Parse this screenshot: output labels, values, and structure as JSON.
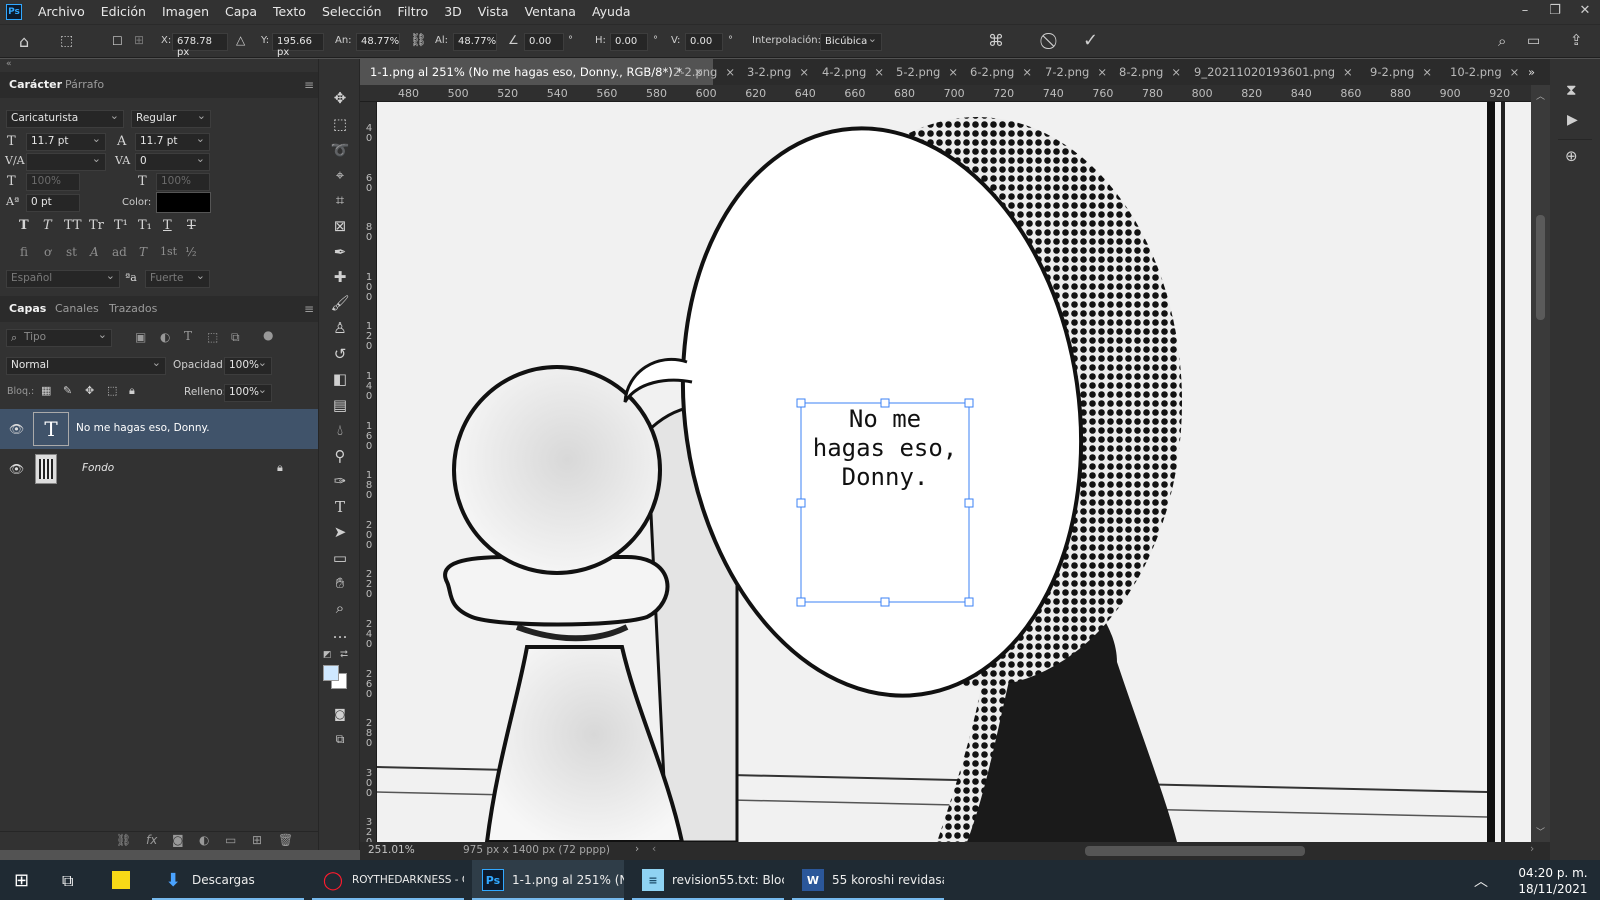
{
  "menu": {
    "logo": "Ps",
    "items": [
      "Archivo",
      "Edición",
      "Imagen",
      "Capa",
      "Texto",
      "Selección",
      "Filtro",
      "3D",
      "Vista",
      "Ventana",
      "Ayuda"
    ],
    "window_controls": [
      "–",
      "❐",
      "✕"
    ]
  },
  "options": {
    "x_label": "X:",
    "x_value": "678.78 px",
    "y_label": "Y:",
    "y_value": "195.66 px",
    "w_label": "An:",
    "w_value": "48.77%",
    "h_label": "Al:",
    "h_value": "48.77%",
    "angle_value": "0.00",
    "deg": "°",
    "hskew_label": "H:",
    "hskew_value": "0.00",
    "vskew_label": "V:",
    "vskew_value": "0.00",
    "interp_label": "Interpolación:",
    "interp_value": "Bicúbica"
  },
  "tabs": {
    "active": "1-1.png al 251% (No me hagas eso, Donny., RGB/8*) *",
    "others": [
      "2-2.png",
      "3-2.png",
      "4-2.png",
      "5-2.png",
      "6-2.png",
      "7-2.png",
      "8-2.png",
      "9_20211020193601.png",
      "9-2.png",
      "10-2.png"
    ],
    "more": "»"
  },
  "character_panel": {
    "tab_character": "Carácter",
    "tab_paragraph": "Párrafo",
    "font_family": "Caricaturista",
    "font_style": "Regular",
    "font_size": "11.7 pt",
    "leading": "11.7 pt",
    "kerning": "",
    "tracking": "0",
    "vscale": "100%",
    "hscale": "100%",
    "baseline": "0 pt",
    "color_label": "Color:",
    "text_color": "#000000",
    "style_glyphs": [
      "T",
      "T",
      "TT",
      "Tr",
      "T¹",
      "T₁",
      "T",
      "T"
    ],
    "opentype_glyphs": [
      "fi",
      "ơ",
      "st",
      "A",
      "ad",
      "T",
      "1st",
      "½"
    ],
    "language": "Español",
    "aa_label": "ªa",
    "antialias": "Fuerte"
  },
  "layers_panel": {
    "tab_layers": "Capas",
    "tab_channels": "Canales",
    "tab_paths": "Trazados",
    "filter_kind": "Tipo",
    "blend_mode": "Normal",
    "opacity_label": "Opacidad:",
    "opacity": "100%",
    "lock_label": "Bloq.:",
    "fill_label": "Relleno:",
    "fill": "100%",
    "layers": [
      {
        "name": "No me hagas eso, Donny.",
        "type_glyph": "T"
      },
      {
        "name": "Fondo"
      }
    ]
  },
  "rulers": {
    "top": [
      "480",
      "500",
      "520",
      "540",
      "560",
      "580",
      "600",
      "620",
      "640",
      "660",
      "680",
      "700",
      "720",
      "740",
      "760",
      "780",
      "800",
      "820",
      "840",
      "860",
      "880",
      "900",
      "920"
    ],
    "left": [
      "40",
      "60",
      "80",
      "100",
      "120",
      "140",
      "160",
      "180",
      "200",
      "220",
      "240",
      "260",
      "280",
      "300",
      "320"
    ]
  },
  "canvas": {
    "speech_text": [
      "No me",
      "hagas eso,",
      "Donny."
    ]
  },
  "status": {
    "zoom": "251.01%",
    "doc_size": "975 px x 1400 px (72 pppp)"
  },
  "taskbar": {
    "items": [
      {
        "label": "Descargas"
      },
      {
        "label": "ROYTHEDARKNESS - O..."
      },
      {
        "label": "1-1.png al 251% (N..."
      },
      {
        "label": "revision55.txt: Bloc ..."
      },
      {
        "label": "55 koroshi revidasa..."
      }
    ],
    "time": "04:20 p. m.",
    "date": "18/11/2021"
  }
}
